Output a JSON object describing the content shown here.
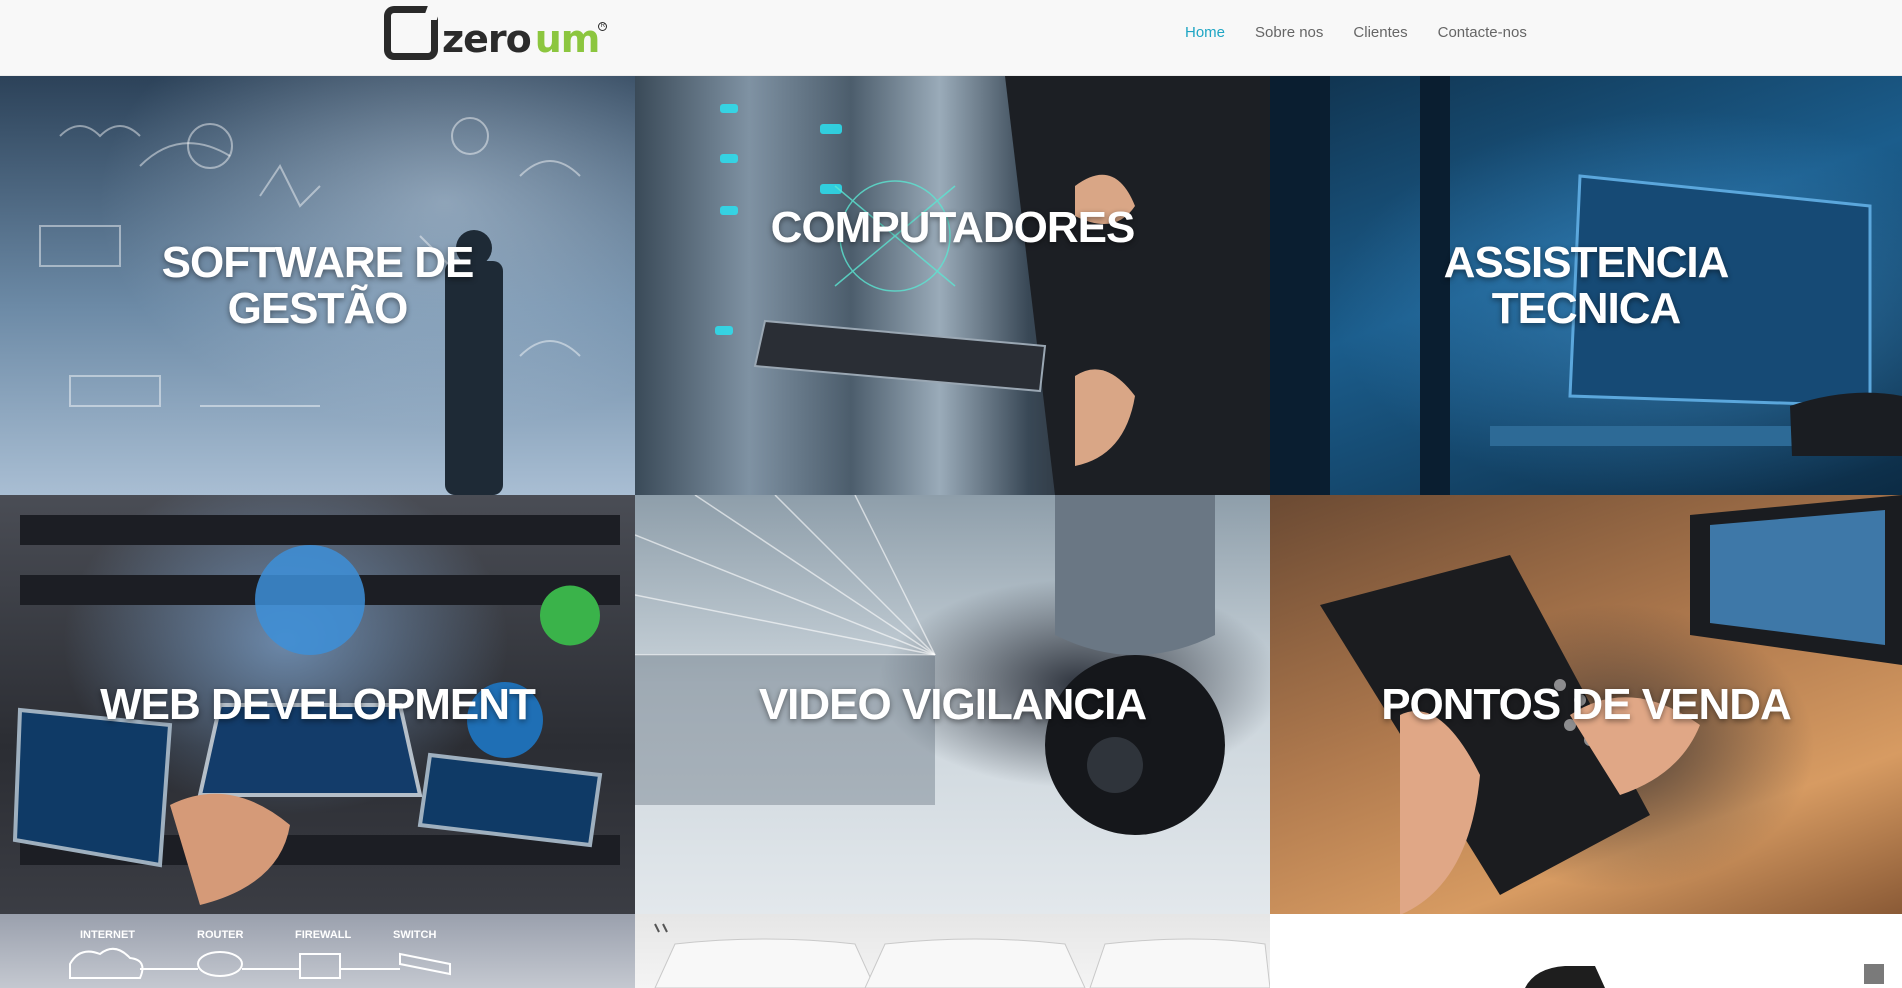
{
  "brand": {
    "logo_text_dark": "zero",
    "logo_text_green": "um",
    "logo_colors": {
      "dark": "#2b2b2b",
      "green": "#8cc63f"
    }
  },
  "nav": {
    "items": [
      {
        "label": "Home",
        "active": true
      },
      {
        "label": "Sobre nos",
        "active": false
      },
      {
        "label": "Clientes",
        "active": false
      },
      {
        "label": "Contacte-nos",
        "active": false
      }
    ],
    "active_color": "#1fa6c4",
    "text_color": "#666666"
  },
  "tiles": [
    {
      "caption_line1": "SOFTWARE DE",
      "caption_line2": "GESTÃO",
      "image": "business-sketch-photo"
    },
    {
      "caption_line1": "COMPUTADORES",
      "caption_line2": "",
      "image": "server-tablet-photo"
    },
    {
      "caption_line1": "ASSISTENCIA",
      "caption_line2": "TECNICA",
      "image": "server-rack-photo"
    },
    {
      "caption_line1": "WEB DEVELOPMENT",
      "caption_line2": "",
      "image": "devices-globe-photo"
    },
    {
      "caption_line1": "VIDEO VIGILANCIA",
      "caption_line2": "",
      "image": "security-camera-photo"
    },
    {
      "caption_line1": "PONTOS DE VENDA",
      "caption_line2": "",
      "image": "payment-terminal-photo"
    },
    {
      "caption_line1": "",
      "caption_line2": "",
      "image": "network-diagram-photo",
      "labels": [
        "INTERNET",
        "ROUTER",
        "FIREWALL",
        "SWITCH"
      ]
    },
    {
      "caption_line1": "",
      "caption_line2": "",
      "image": "keyboard-photo"
    },
    {
      "caption_line1": "",
      "caption_line2": "",
      "image": "logo-partial"
    }
  ],
  "icons": {
    "scroll_top": "scroll-to-top-icon"
  }
}
